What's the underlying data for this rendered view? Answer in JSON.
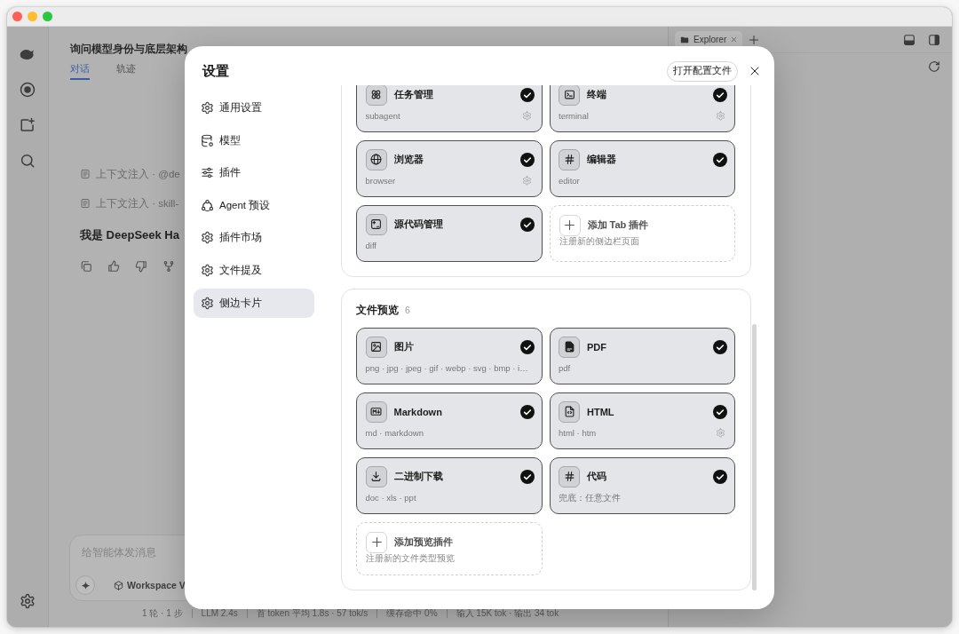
{
  "app": {
    "conversation": {
      "title": "询问模型身份与底层架构",
      "tabs": [
        {
          "label": "对话",
          "selected": true
        },
        {
          "label": "轨迹",
          "selected": false
        }
      ],
      "context_rows": [
        "上下文注入 · @de",
        "上下文注入 · skill-"
      ],
      "reply": "我是 DeepSeek Ha",
      "composer": {
        "placeholder": "给智能体发消息",
        "workspace": "Workspace V"
      },
      "status_bar": [
        "1 轮 · 1 步",
        "LLM 2.4s",
        "首 token 平均 1.8s · 57 tok/s",
        "缓存命中 0%",
        "输入 15K tok · 输出 34 tok"
      ]
    },
    "explorer": {
      "tabs": [
        {
          "label": "Explorer",
          "selected": true
        }
      ]
    }
  },
  "settings": {
    "title": "设置",
    "open_config_button": "打开配置文件",
    "nav": [
      {
        "label": "通用设置",
        "selected": false
      },
      {
        "label": "模型",
        "selected": false
      },
      {
        "label": "插件",
        "selected": false
      },
      {
        "label": "Agent 预设",
        "selected": false
      },
      {
        "label": "插件市场",
        "selected": false
      },
      {
        "label": "文件提及",
        "selected": false
      },
      {
        "label": "侧边卡片",
        "selected": true
      }
    ],
    "sections": [
      {
        "cards": [
          {
            "title": "任务管理",
            "subtitle": "subagent",
            "enabled": true,
            "settings_button": true
          },
          {
            "title": "终端",
            "subtitle": "terminal",
            "enabled": true,
            "settings_button": true
          },
          {
            "title": "浏览器",
            "subtitle": "browser",
            "enabled": true,
            "settings_button": true
          },
          {
            "title": "编辑器",
            "subtitle": "editor",
            "enabled": true,
            "settings_button": false
          },
          {
            "title": "源代码管理",
            "subtitle": "diff",
            "enabled": true,
            "settings_button": false
          }
        ],
        "add_card": {
          "title": "添加 Tab 插件",
          "subtitle": "注册新的侧边栏页面"
        }
      },
      {
        "title": "文件预览",
        "count": "6",
        "cards": [
          {
            "title": "图片",
            "subtitle": "png · jpg · jpeg · gif · webp · svg · bmp · i…",
            "enabled": true,
            "settings_button": false
          },
          {
            "title": "PDF",
            "subtitle": "pdf",
            "enabled": true,
            "settings_button": false
          },
          {
            "title": "Markdown",
            "subtitle": "md · markdown",
            "enabled": true,
            "settings_button": false
          },
          {
            "title": "HTML",
            "subtitle": "html · htm",
            "enabled": true,
            "settings_button": true
          },
          {
            "title": "二进制下载",
            "subtitle": "doc · xls · ppt",
            "enabled": true,
            "settings_button": false
          },
          {
            "title": "代码",
            "subtitle": "兜底：任意文件",
            "enabled": true,
            "settings_button": false
          }
        ],
        "add_card": {
          "title": "添加预览插件",
          "subtitle": "注册新的文件类型预览"
        }
      }
    ]
  }
}
